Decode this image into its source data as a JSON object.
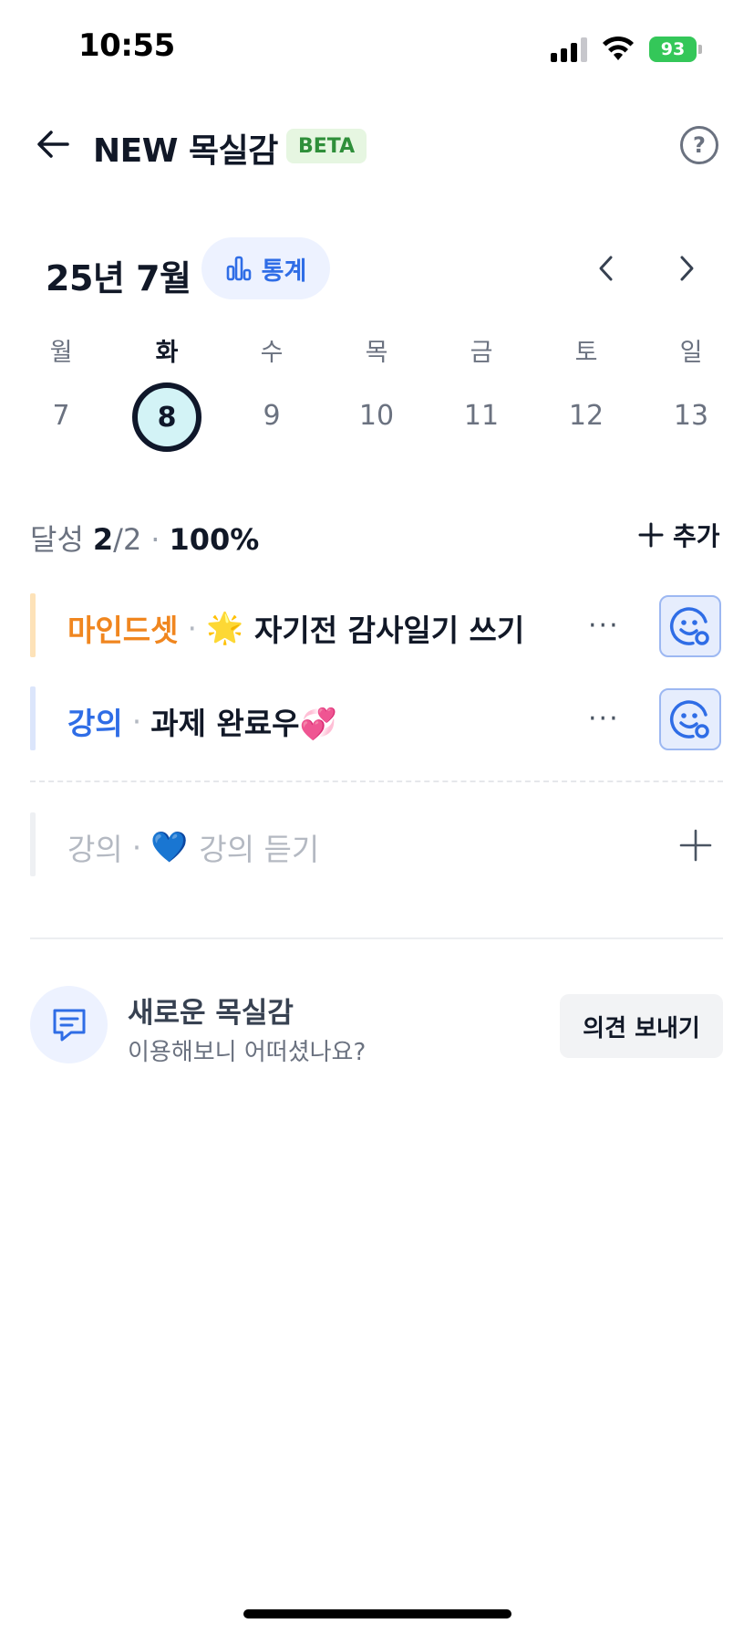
{
  "status": {
    "time": "10:55",
    "battery": "93"
  },
  "header": {
    "title": "NEW 목실감",
    "badge": "BETA",
    "help_glyph": "?"
  },
  "calendar": {
    "month_label": "25년 7월",
    "stats_label": "통계",
    "weekdays": [
      "월",
      "화",
      "수",
      "목",
      "금",
      "토",
      "일"
    ],
    "days": [
      "7",
      "8",
      "9",
      "10",
      "11",
      "12",
      "13"
    ],
    "selected_index": 1
  },
  "achievement": {
    "label": "달성",
    "done": "2",
    "total": "/2",
    "separator": "·",
    "percent": "100%"
  },
  "add_label": "추가",
  "goals": [
    {
      "category": "마인드셋",
      "category_color": "#f0861f",
      "bar_color": "#fde2b8",
      "emoji": "🌟",
      "title": "자기전 감사일기 쓰기",
      "separator": "·",
      "more": "···",
      "completed": true
    },
    {
      "category": "강의",
      "category_color": "#2f6de6",
      "bar_color": "#dbe5fb",
      "emoji": "",
      "title": "과제 완료우💞",
      "separator": "·",
      "more": "···",
      "completed": true
    }
  ],
  "suggested_goal": {
    "category": "강의",
    "separator": "·",
    "emoji": "💙",
    "title": "강의 듣기",
    "bar_color": "#eef0f3"
  },
  "feedback": {
    "title": "새로운 목실감",
    "subtitle": "이용해보니 어떠셨나요?",
    "button_label": "의견 보내기"
  },
  "icons": [
    "back-arrow-icon",
    "help-icon",
    "bar-chart-icon",
    "chevron-left-icon",
    "chevron-right-icon",
    "plus-icon",
    "smile-check-icon",
    "chat-bubble-icon"
  ],
  "colors": {
    "accent": "#2f6de6",
    "today_fill": "#d3f3f6",
    "beta_bg": "#e6f6e1",
    "beta_fg": "#2f8f3a"
  }
}
